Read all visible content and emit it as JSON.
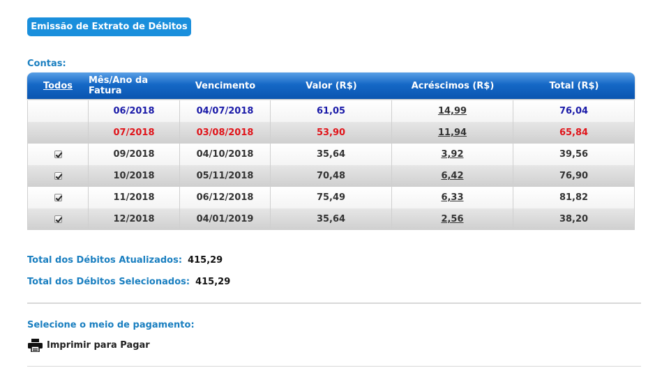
{
  "header": {
    "button_label": "Emissão de Extrato de Débitos"
  },
  "contas_label": "Contas:",
  "table": {
    "columns": [
      "Todos",
      "Mês/Ano da Fatura",
      "Vencimento",
      "Valor (R$)",
      "Acréscimos (R$)",
      "Total (R$)"
    ],
    "rows": [
      {
        "checked": false,
        "status": "blue",
        "mes": "06/2018",
        "venc": "04/07/2018",
        "valor": "61,05",
        "acresc": "14,99",
        "total": "76,04"
      },
      {
        "checked": false,
        "status": "red",
        "mes": "07/2018",
        "venc": "03/08/2018",
        "valor": "53,90",
        "acresc": "11,94",
        "total": "65,84"
      },
      {
        "checked": true,
        "status": "normal",
        "mes": "09/2018",
        "venc": "04/10/2018",
        "valor": "35,64",
        "acresc": "3,92",
        "total": "39,56"
      },
      {
        "checked": true,
        "status": "normal",
        "mes": "10/2018",
        "venc": "05/11/2018",
        "valor": "70,48",
        "acresc": "6,42",
        "total": "76,90"
      },
      {
        "checked": true,
        "status": "normal",
        "mes": "11/2018",
        "venc": "06/12/2018",
        "valor": "75,49",
        "acresc": "6,33",
        "total": "81,82"
      },
      {
        "checked": true,
        "status": "normal",
        "mes": "12/2018",
        "venc": "04/01/2019",
        "valor": "35,64",
        "acresc": "2,56",
        "total": "38,20"
      }
    ]
  },
  "totais": {
    "atualizados_label": "Total dos Débitos Atualizados:",
    "atualizados_value": "415,29",
    "selecionados_label": "Total dos Débitos Selecionados:",
    "selecionados_value": "415,29"
  },
  "pagamento": {
    "label": "Selecione o meio de pagamento:",
    "print_label": "Imprimir para Pagar",
    "print_icon": "printer-icon"
  },
  "colors": {
    "accent": "#1a7fc0",
    "button": "#1a8fdc",
    "overdue": "#e0141a",
    "current": "#1a1aa8"
  }
}
